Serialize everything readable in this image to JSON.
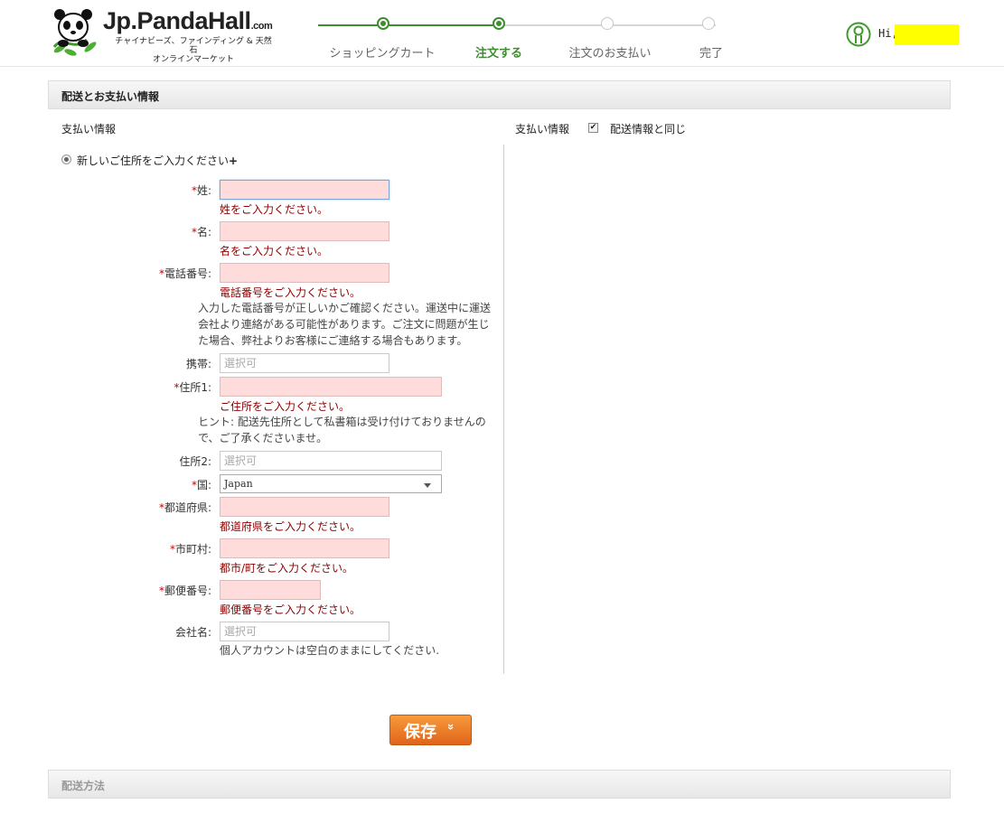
{
  "header": {
    "logo_name": "Jp.PandaHall",
    "logo_suffix": ".com",
    "logo_tagline_1": "チャイナビーズ、ファインディング & 天然石",
    "logo_tagline_2": "オンラインマーケット",
    "greeting": "Hi,",
    "steps": [
      {
        "label": "ショッピングカート",
        "state": "done"
      },
      {
        "label": "注文する",
        "state": "current"
      },
      {
        "label": "注文のお支払い",
        "state": "todo"
      },
      {
        "label": "完了",
        "state": "todo"
      }
    ],
    "colors": {
      "accent_green": "#3e8e2f",
      "highlight_yellow": "#ffff00"
    }
  },
  "section": {
    "title": "配送とお支払い情報",
    "left_title": "支払い情報",
    "right_title": "支払い情報",
    "same_as_shipping_label": "配送情報と同じ",
    "same_as_shipping_checked": true,
    "new_address_label": "新しいご住所をご入力ください",
    "new_address_plus": "+"
  },
  "form": {
    "last_name": {
      "label": "姓:",
      "value": "",
      "error": "姓をご入力ください。"
    },
    "first_name": {
      "label": "名:",
      "value": "",
      "error": "名をご入力ください。"
    },
    "phone": {
      "label": "電話番号:",
      "value": "",
      "error": "電話番号をご入力ください。",
      "note": "入力した電話番号が正しいかご確認ください。運送中に運送会社より連絡がある可能性があります。ご注文に問題が生じた場合、弊社よりお客様にご連絡する場合もあります。"
    },
    "mobile": {
      "label": "携帯:",
      "placeholder": "選択可"
    },
    "address1": {
      "label": "住所1:",
      "value": "",
      "error": "ご住所をご入力ください。",
      "note": "ヒント: 配送先住所として私書箱は受け付けておりませんので、ご了承くださいませ。"
    },
    "address2": {
      "label": "住所2:",
      "placeholder": "選択可"
    },
    "country": {
      "label": "国:",
      "selected": "Japan"
    },
    "prefecture": {
      "label": "都道府県:",
      "value": "",
      "error": "都道府県をご入力ください。"
    },
    "city": {
      "label": "市町村:",
      "value": "",
      "error": "都市/町をご入力ください。"
    },
    "zip": {
      "label": "郵便番号:",
      "value": "",
      "error": "郵便番号をご入力ください。"
    },
    "company": {
      "label": "会社名:",
      "placeholder": "選択可",
      "note": "個人アカウントは空白のままにしてください."
    },
    "required_mark": "*",
    "save_label": "保存",
    "save_chevron": "»",
    "colors": {
      "error_bg": "#ffdcdc",
      "error_text": "#8b0000",
      "button_orange": "#e8731f"
    }
  },
  "shipping_section": {
    "title": "配送方法"
  }
}
